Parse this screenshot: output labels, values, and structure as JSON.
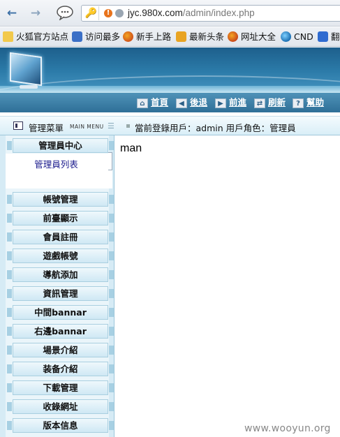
{
  "browser": {
    "url_domain": "jyc.980x.com",
    "url_path": "/admin/index.php"
  },
  "bookmarks": [
    {
      "label": "火狐官方站点",
      "icon": "folder-icon"
    },
    {
      "label": "访问最多",
      "icon": "search-page-icon"
    },
    {
      "label": "新手上路",
      "icon": "firefox-icon"
    },
    {
      "label": "最新头条",
      "icon": "rss-icon"
    },
    {
      "label": "网址大全",
      "icon": "firefox-icon"
    },
    {
      "label": "CND",
      "icon": "globe-icon"
    },
    {
      "label": "翻",
      "icon": "translate-icon"
    }
  ],
  "toolbar": {
    "home": "首頁",
    "back": "後退",
    "forward": "前進",
    "refresh": "刷新",
    "help": "幫助"
  },
  "infobar": {
    "menu_title": "管理菜單",
    "menu_sub": "MAIN MENU",
    "user_info": "當前登錄用戶：admin  用戶角色：管理員"
  },
  "sidebar": {
    "section_title": "管理員中心",
    "sub_items": [
      "管理員列表"
    ],
    "categories": [
      "帳號管理",
      "前臺顯示",
      "會員註冊",
      "遊戲帳號",
      "導航添加",
      "資訊管理",
      "中間bannar",
      "右邊bannar",
      "場景介紹",
      "装备介紹",
      "下載管理",
      "收錄網址",
      "版本信息"
    ]
  },
  "main": {
    "message": "man"
  },
  "watermark": "www.wooyun.org"
}
